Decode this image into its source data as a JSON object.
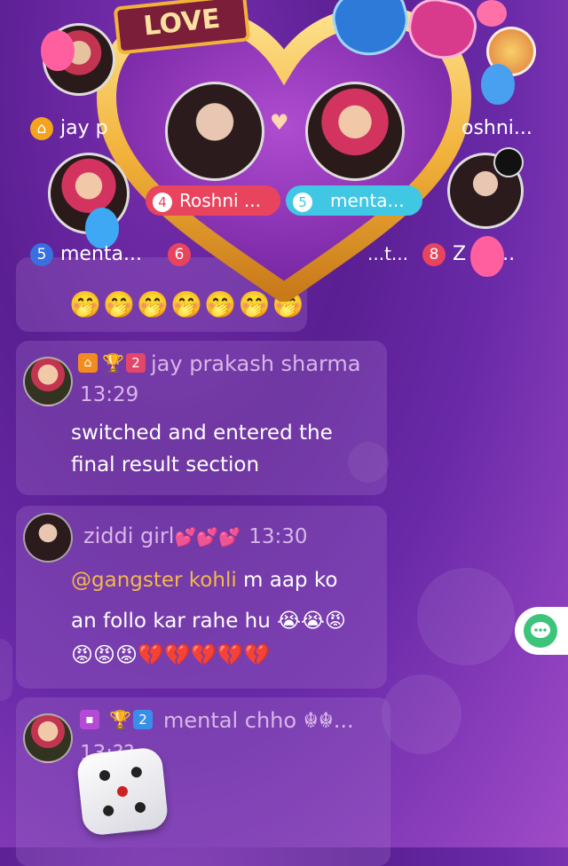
{
  "top": {
    "love_banner": "LOVE",
    "pair_left_name": "Roshni ...",
    "pair_left_num": "4",
    "pair_right_name": "menta...",
    "pair_right_num": "5",
    "seat1_name": "jay p",
    "seat2_name": "oshni...",
    "seat3_num": "5",
    "seat3_name": "menta...",
    "seat3_extra_num": "6",
    "seat4_name": "...t...",
    "seat5_num": "8",
    "seat5_name": "Z i g..."
  },
  "messages": [
    {
      "emoji_row": "🤭🤭🤭🤭🤭🤭🤭"
    },
    {
      "level": "2",
      "username": "jay prakash sharma",
      "time": "13:29",
      "text_line1": "switched and entered the",
      "text_line2": "final result section"
    },
    {
      "username": "ziddi girl",
      "user_hearts": "💕💕💕",
      "time": "13:30",
      "mention": "@gangster kohli",
      "text_line1_rest": " m aap ko",
      "text_line2": "an follo kar rahe hu 😭😭😡",
      "text_line3": "😡😡😡💔💔💔💔💔"
    },
    {
      "level": "2",
      "username": "mental chho ☬☬...",
      "time": "13:??"
    }
  ],
  "colors": {
    "accent_gold": "#f2b23a",
    "pill_red": "#e8445e",
    "pill_cyan": "#3fc7e3",
    "chat_button": "#3cc47a"
  }
}
